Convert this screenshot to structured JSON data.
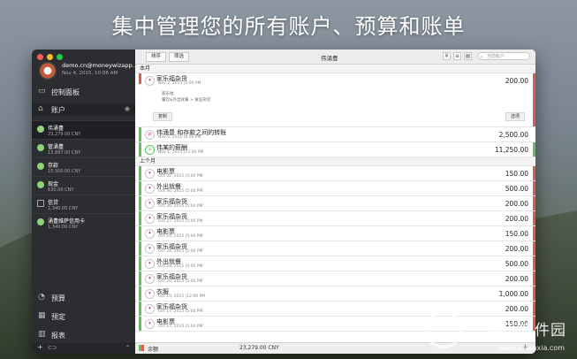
{
  "headline": "集中管理您的所有账户、预算和账单",
  "sidebar": {
    "account_email": "demo.cn@moneywizapp...",
    "account_date": "Nov 4, 2015, 10:08 AM",
    "nav_dashboard": "控制面板",
    "nav_accounts": "账户",
    "eye_icon": "eye-icon",
    "accounts": [
      {
        "name": "伟涌豊",
        "balance": "23,279.00 CNY"
      },
      {
        "name": "管涌豊",
        "balance": "13,897.00 CNY"
      },
      {
        "name": "存款",
        "balance": "15,500.00 CNY"
      },
      {
        "name": "现金",
        "balance": "630.00 CNY"
      },
      {
        "name": "信贷",
        "balance": "1,340.00 CNY"
      },
      {
        "name": "涌豊维萨信用卡",
        "balance": "1,340.00 CNY"
      }
    ],
    "nav_budget": "预算",
    "nav_scheduled": "预定",
    "nav_reports": "报表"
  },
  "toolbar": {
    "sort_label": "排序",
    "filter_label": "筛选",
    "title": "伟涌豊",
    "search_placeholder": "当前帐户"
  },
  "list": {
    "section_this_month": "本月",
    "section_last_month": "上个月",
    "detail": {
      "title": "家乐福杂货",
      "date": "Nov 2, 2015 |5:00 PM",
      "amount": "200.00",
      "payee": "家乐福",
      "category_path": "餐饮&外出就餐 > 食品杂货",
      "duplicate_label": "复制",
      "options_label": "选项"
    },
    "this_month": [
      {
        "title": "伟涌豊 和存款之间的转账",
        "date": "Nov 2, 2015 |6:00 PM",
        "amount": "2,500.00"
      },
      {
        "title": "伟某的薪酬",
        "date": "Nov 1, 2015 |12:00 PM",
        "amount": "11,250.00"
      }
    ],
    "last_month": [
      {
        "title": "电影票",
        "date": "Oct 31, 2015 |5:00 PM",
        "amount": "150.00"
      },
      {
        "title": "外出就餐",
        "date": "Oct 30, 2015 |5:00 PM",
        "amount": "500.00"
      },
      {
        "title": "家乐福杂货",
        "date": "Oct 26, 2015 |5:00 PM",
        "amount": "200.00"
      },
      {
        "title": "家乐福杂货",
        "date": "Oct 27, 2015 |5:00 PM",
        "amount": "200.00"
      },
      {
        "title": "电影票",
        "date": "Oct 24, 2015 |5:00 PM",
        "amount": "150.00"
      },
      {
        "title": "家乐福杂货",
        "date": "Oct 24, 2015 |5:00 PM",
        "amount": "200.00"
      },
      {
        "title": "外出就餐",
        "date": "Oct 24, 2015 |5:00 PM",
        "amount": "500.00"
      },
      {
        "title": "家乐福杂货",
        "date": "Oct 20, 2015 |5:00 PM",
        "amount": "200.00"
      },
      {
        "title": "衣服",
        "date": "Oct 19, 2015 |12:00 PM",
        "amount": "1,000.00"
      },
      {
        "title": "家乐福杂货",
        "date": "Oct 17, 2015 |5:00 PM",
        "amount": "200.00"
      },
      {
        "title": "电影票",
        "date": "Oct 17, 2015 |5:00 PM",
        "amount": "150.00"
      }
    ]
  },
  "footer": {
    "balance_label": "余额",
    "balance_value": "23,279.00 CNY",
    "add_label": "+"
  },
  "watermark": {
    "brand": "当下软件园",
    "url": "www.downxia.com"
  },
  "colors": {
    "income": "#5cc35b",
    "expense": "#e05a4a",
    "sidebar_bg": "#2c2d30"
  }
}
